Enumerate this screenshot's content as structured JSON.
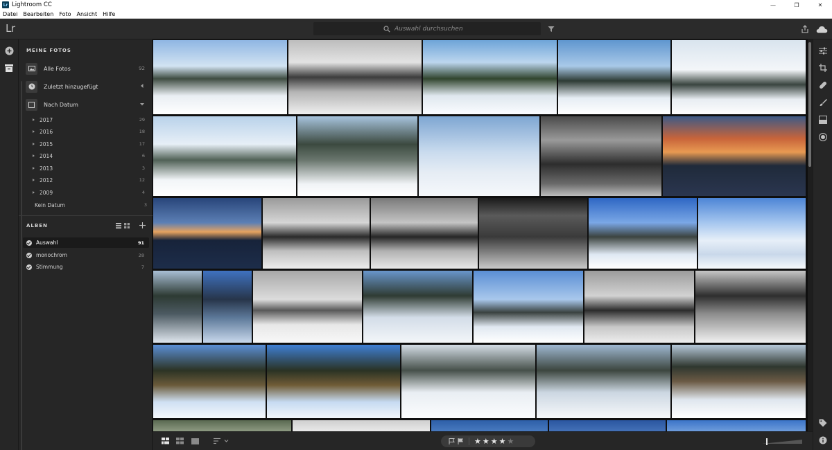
{
  "window": {
    "title": "Lightroom CC",
    "app_icon_text": "Lr"
  },
  "menu": [
    "Datei",
    "Bearbeiten",
    "Foto",
    "Ansicht",
    "Hilfe"
  ],
  "header": {
    "logo": "Lr",
    "search_placeholder": "Auswahl durchsuchen"
  },
  "sidebar": {
    "my_photos_title": "MEINE FOTOS",
    "all_photos": {
      "label": "Alle Fotos",
      "count": "92"
    },
    "recently_added": {
      "label": "Zuletzt hinzugefügt"
    },
    "by_date": {
      "label": "Nach Datum"
    },
    "years": [
      {
        "label": "2017",
        "count": "29"
      },
      {
        "label": "2016",
        "count": "18"
      },
      {
        "label": "2015",
        "count": "17"
      },
      {
        "label": "2014",
        "count": "6"
      },
      {
        "label": "2013",
        "count": "3"
      },
      {
        "label": "2012",
        "count": "12"
      },
      {
        "label": "2009",
        "count": "4"
      }
    ],
    "no_date": {
      "label": "Kein Datum",
      "count": "3"
    },
    "albums_title": "ALBEN",
    "albums": [
      {
        "label": "Auswahl",
        "count": "91",
        "active": true
      },
      {
        "label": "monochrom",
        "count": "28",
        "active": false
      },
      {
        "label": "Stimmung",
        "count": "7",
        "active": false
      }
    ]
  },
  "bottom": {
    "rating": {
      "stars_filled": 4,
      "stars_total": 5
    }
  },
  "colors": {
    "panel": "#262626",
    "grid_bg": "#0f0f0f",
    "text": "#d9d9d9",
    "muted": "#8c8c8c"
  }
}
